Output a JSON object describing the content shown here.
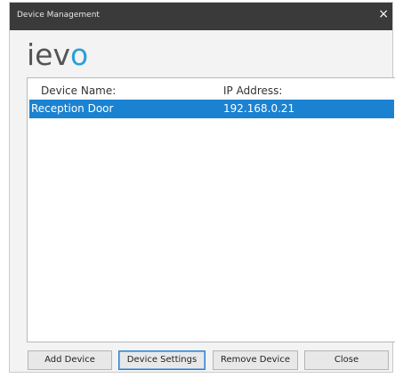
{
  "window": {
    "title": "Device Management",
    "close_glyph": "×"
  },
  "logo": {
    "part1": "iev",
    "part2": "o",
    "colors": {
      "text": "#555555",
      "accent": "#2aa0d6"
    }
  },
  "list": {
    "columns": [
      "Device Name:",
      "IP Address:"
    ],
    "rows": [
      {
        "device_name": "Reception Door",
        "ip_address": "192.168.0.21",
        "selected": true
      }
    ],
    "selection_color": "#1b82d1"
  },
  "buttons": {
    "add": "Add Device",
    "settings": "Device Settings",
    "remove": "Remove Device",
    "close": "Close"
  }
}
